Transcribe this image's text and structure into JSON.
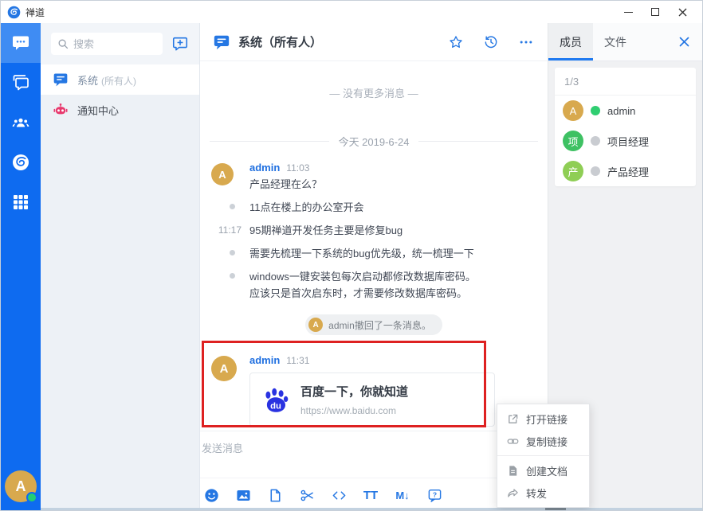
{
  "window": {
    "app_title": "禅道"
  },
  "colors": {
    "accent_blue": "#2577e3",
    "sidebar_blue": "#0e6bf0",
    "sidebar_active_blue": "#3f8cf3",
    "annotation_red": "#de2121",
    "avatar_gold": "#d8a94e",
    "online_green": "#2fce71",
    "offline_gray": "#c9ccd1",
    "member_green": "#3ec163",
    "member_light_green": "#8fce55",
    "robot_pink": "#e8386d",
    "baidu_blue": "#2932e1"
  },
  "nav": {
    "user_initial": "A"
  },
  "chat_list": {
    "search_placeholder": "搜索",
    "items": [
      {
        "name": "系统",
        "suffix": "(所有人)"
      },
      {
        "name": "通知中心",
        "suffix": ""
      }
    ]
  },
  "chat": {
    "title": "系统（所有人）",
    "no_more_text": "— 没有更多消息 —",
    "date_divider": "今天 2019-6-24",
    "messages": [
      {
        "sender": "admin",
        "avatar": "A",
        "time": "11:03",
        "text": "产品经理在么？"
      },
      {
        "text": "11点在楼上的办公室开会"
      },
      {
        "time": "11:17",
        "text": "95期禅道开发任务主要是修复bug"
      },
      {
        "text": "需要先梳理一下系统的bug优先级，统一梳理一下"
      },
      {
        "text": "windows一键安装包每次启动都修改数据库密码。",
        "text2": "应该只是首次启东时，才需要修改数据库密码。"
      },
      {
        "type": "recall",
        "avatar": "A",
        "text": "admin撤回了一条消息。"
      },
      {
        "sender": "admin",
        "avatar": "A",
        "time": "11:31",
        "card": {
          "title": "百度一下，你就知道",
          "url": "https://www.baidu.com"
        }
      }
    ]
  },
  "composer": {
    "placeholder": "发送消息",
    "toolbar": {
      "text_format_glyph": "TT",
      "markdown_glyph": "M↓"
    }
  },
  "right_panel": {
    "tabs": [
      {
        "label": "成员"
      },
      {
        "label": "文件"
      }
    ],
    "member_count": "1/3",
    "members": [
      {
        "initial": "A",
        "name": "admin",
        "online": true
      },
      {
        "initial": "项",
        "name": "项目经理",
        "online": false
      },
      {
        "initial": "产",
        "name": "产品经理",
        "online": false
      }
    ]
  },
  "context_menu": {
    "items": [
      {
        "label": "打开链接"
      },
      {
        "label": "复制链接"
      },
      {
        "label": "创建文档"
      },
      {
        "label": "转发"
      }
    ]
  }
}
